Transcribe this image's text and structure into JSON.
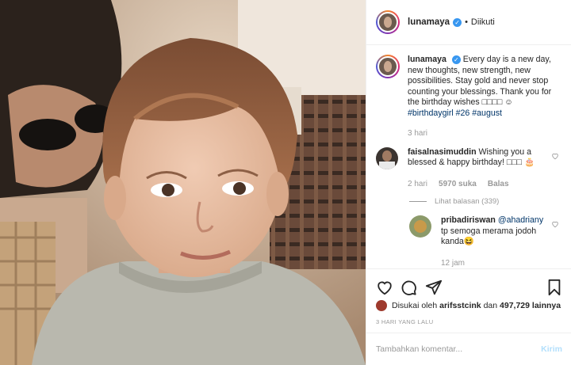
{
  "post": {
    "photo_alt": "photo",
    "author": {
      "username": "lunamaya",
      "verified_icon": "verified-badge-icon",
      "separator": "•",
      "follow_status": "Diikuti"
    },
    "caption": {
      "username": "lunamaya",
      "text": "Every day is a new day, new thoughts, new strength, new possibilities. Stay gold and never stop counting your blessings. Thank you for the birthday wishes □□□□ ☺",
      "hashtags": "#birthdaygirl #26 #august",
      "time": "3 hari"
    },
    "comments": [
      {
        "username": "faisalnasimuddin",
        "text": "Wishing you a blessed & happy birthday! □□□ 🎂",
        "time": "2 hari",
        "likes": "5970 suka",
        "reply_label": "Balas",
        "view_replies": "Lihat balasan (339)"
      },
      {
        "username": "pribadiriswan",
        "mention": "@ahadriany",
        "text": "tp semoga merama jodoh kanda😆",
        "time": "12 jam"
      }
    ],
    "liked_by": {
      "prefix": "Disukai oleh",
      "user": "arifsstcink",
      "connector": "dan",
      "count": "497,729",
      "suffix": "lainnya"
    },
    "date": "3 HARI YANG LALU",
    "comment_box": {
      "placeholder": "Tambahkan komentar...",
      "post_label": "Kirim"
    },
    "icons": [
      "heart-icon",
      "comment-icon",
      "share-icon",
      "bookmark-icon"
    ],
    "colors": {
      "verified": "#3897f0",
      "link": "#003569",
      "muted": "#999999",
      "post_button": "#b2dffc"
    }
  }
}
